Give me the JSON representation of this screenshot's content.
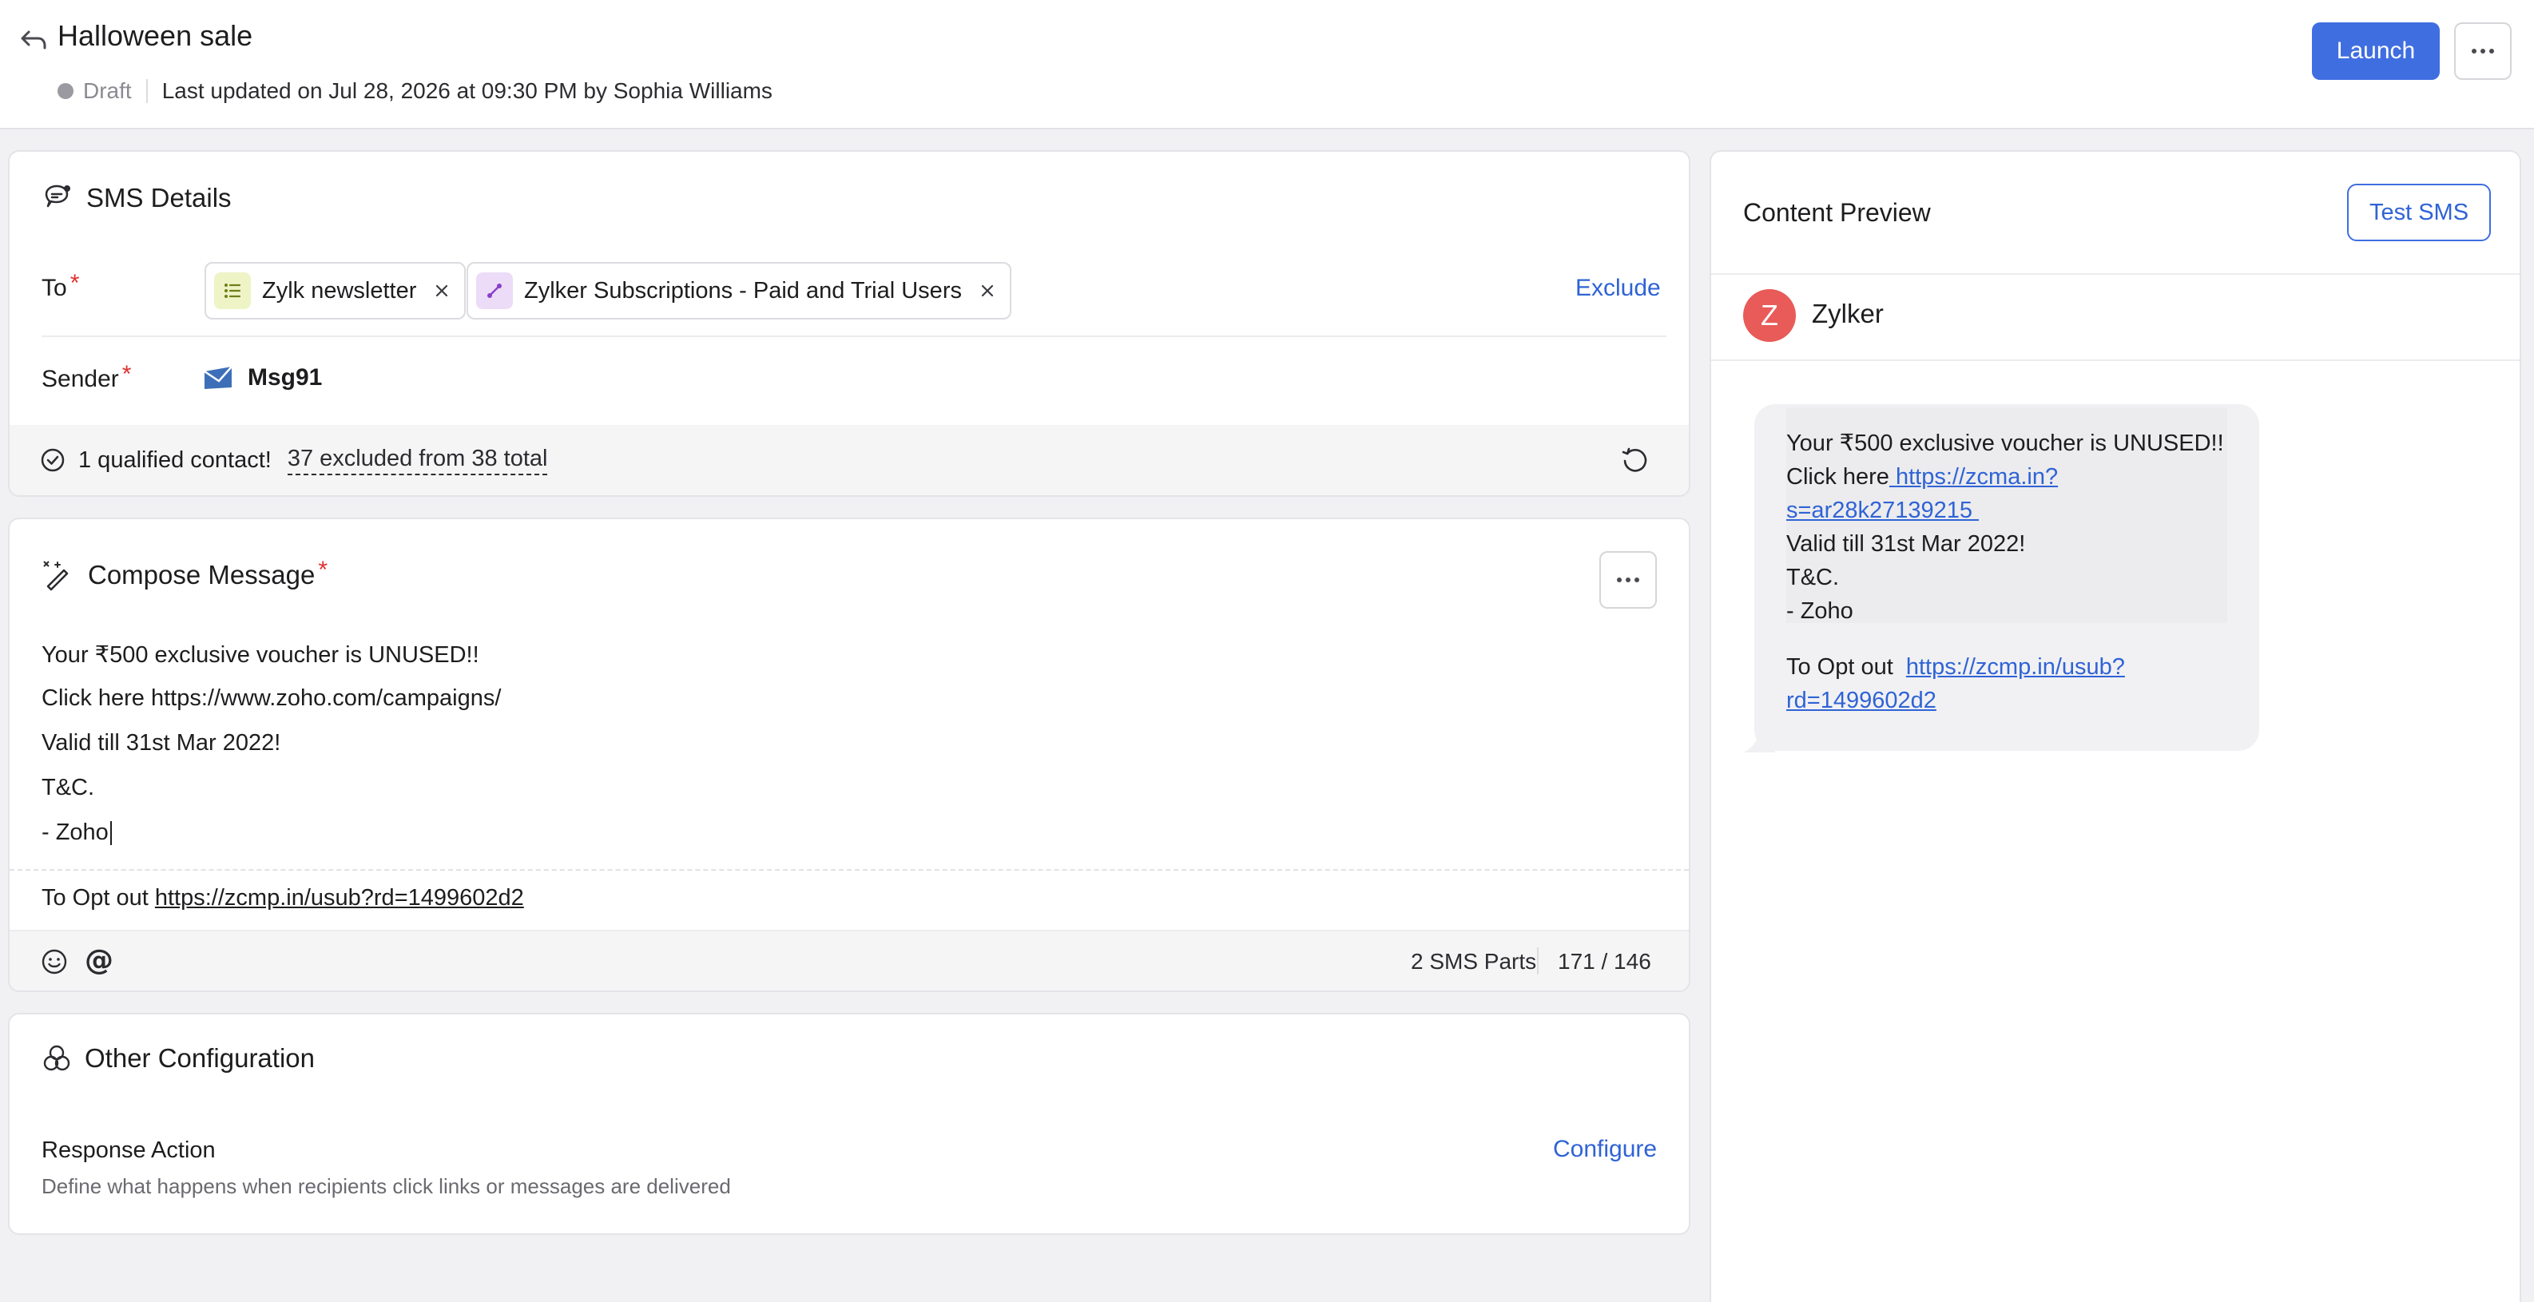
{
  "header": {
    "title": "Halloween sale",
    "status": "Draft",
    "last_updated": "Last updated on Jul 28, 2026 at 09:30 PM by Sophia Williams",
    "launch_label": "Launch"
  },
  "sms_details": {
    "title": "SMS Details",
    "to_label": "To",
    "required_mark": "*",
    "recipients": [
      {
        "label": "Zylk newsletter",
        "icon": "list-icon",
        "icon_bg": "#eef4c6",
        "icon_color": "#7a8a1a"
      },
      {
        "label": "Zylker Subscriptions - Paid and Trial Users",
        "icon": "segment-icon",
        "icon_bg": "#ecdcf7",
        "icon_color": "#8a3fc9"
      }
    ],
    "exclude_label": "Exclude",
    "sender_label": "Sender",
    "sender_name": "Msg91",
    "qualified_text": "1 qualified contact!",
    "excluded_text": "37 excluded from 38 total"
  },
  "compose": {
    "title": "Compose Message",
    "lines": [
      "Your ₹500 exclusive voucher is UNUSED!!",
      "Click here https://www.zoho.com/campaigns/",
      "Valid till 31st Mar 2022!",
      "T&C.",
      "- Zoho"
    ],
    "optout_prefix": "To Opt out",
    "optout_link": "https://zcmp.in/usub?rd=1499602d2",
    "sms_parts": "2 SMS Parts",
    "char_count": "171 / 146"
  },
  "other_config": {
    "title": "Other Configuration",
    "response_action_label": "Response Action",
    "response_action_desc": "Define what happens when recipients click links or messages are delivered",
    "configure_label": "Configure"
  },
  "preview": {
    "title": "Content Preview",
    "test_label": "Test SMS",
    "sender_initial": "Z",
    "sender_name": "Zylker",
    "message": {
      "line1": "Your ₹500 exclusive voucher is UNUSED!!",
      "click_here": "Click here",
      "link_part1": " https://zcma.in?",
      "link_part2": "s=ar28k27139215 ",
      "line4": "Valid till 31st Mar 2022!",
      "line5": "T&C.",
      "line6": "- Zoho",
      "optout_prefix": "To Opt out",
      "optout_link1": "https://zcmp.in/usub?",
      "optout_link2": "rd=1499602d2"
    }
  },
  "colors": {
    "accent": "#3f6ee0",
    "link": "#2f63d6",
    "required": "#e03131",
    "avatar": "#e85b58"
  }
}
